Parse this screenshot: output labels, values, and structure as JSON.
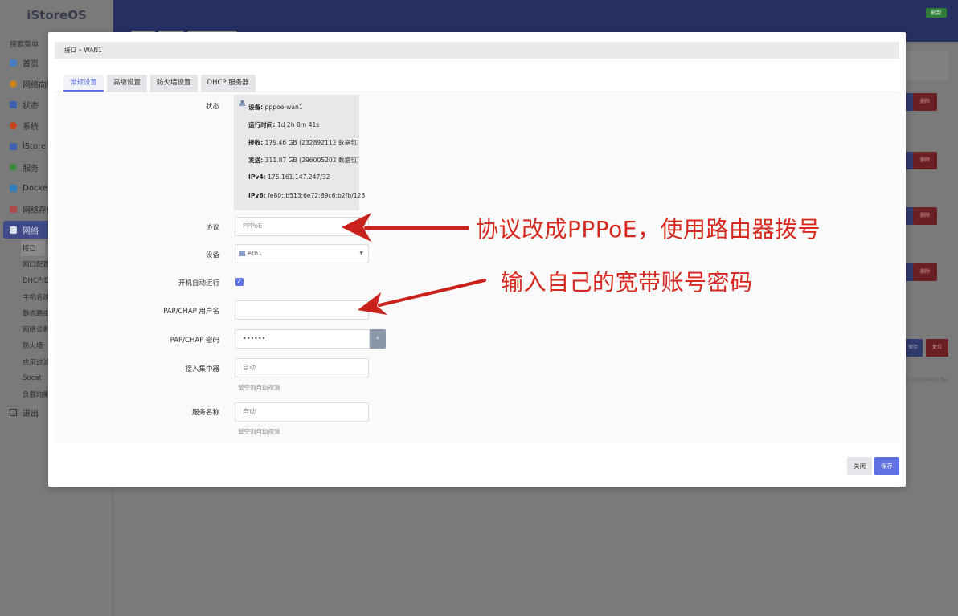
{
  "app": {
    "logo": "iStoreOS",
    "top_badge": "刷新"
  },
  "sidebar": {
    "search_label": "搜索菜单",
    "items": [
      {
        "label": "首页",
        "icon": "home-icon",
        "color": "#4a7bbf"
      },
      {
        "label": "网络向导",
        "icon": "wizard-icon",
        "color": "#c8871a"
      },
      {
        "label": "状态",
        "icon": "grid-icon",
        "color": "#3f5fb0"
      },
      {
        "label": "系统",
        "icon": "system-icon",
        "color": "#c2461e"
      },
      {
        "label": "iStore",
        "icon": "store-icon",
        "color": "#3f5fb0"
      },
      {
        "label": "服务",
        "icon": "service-icon",
        "color": "#3f8a3f"
      },
      {
        "label": "Docker",
        "icon": "docker-icon",
        "color": "#2f7fc0"
      },
      {
        "label": "网络存储",
        "icon": "storage-icon",
        "color": "#b04a4a"
      },
      {
        "label": "网络",
        "icon": "network-icon",
        "color": "#d8dbe9"
      }
    ],
    "sub_items": [
      "接口",
      "网口配置",
      "DHCP/DNS",
      "主机名映射",
      "静态路由",
      "网络诊断",
      "防火墙",
      "应用过滤",
      "Socat",
      "负载均衡"
    ],
    "logout_label": "退出"
  },
  "background": {
    "delete_label": "删除",
    "save_label": "保存",
    "reset_label": "复位",
    "footer": "v2.3-20230602.fnd"
  },
  "modal": {
    "breadcrumb": "接口 » WAN1",
    "tabs": [
      {
        "label": "常规设置",
        "active": true
      },
      {
        "label": "高级设置",
        "active": false
      },
      {
        "label": "防火墙设置",
        "active": false
      },
      {
        "label": "DHCP 服务器",
        "active": false
      }
    ],
    "status": {
      "label": "状态",
      "lines": [
        {
          "key": "设备:",
          "value": "pppoe-wan1"
        },
        {
          "key": "运行时间:",
          "value": "1d 2h 8m 41s"
        },
        {
          "key": "接收:",
          "value": "179.46 GB (232892112 数据包)"
        },
        {
          "key": "发送:",
          "value": "311.87 GB (296005202 数据包)"
        },
        {
          "key": "IPv4:",
          "value": "175.161.147.247/32"
        },
        {
          "key": "IPv6:",
          "value": "fe80::b513:6e72:69c6:b2fb/128"
        }
      ]
    },
    "protocol": {
      "label": "协议",
      "value": "PPPoE"
    },
    "device": {
      "label": "设备",
      "value": "eth1"
    },
    "autostart": {
      "label": "开机自动运行",
      "checked": true
    },
    "username": {
      "label": "PAP/CHAP 用户名",
      "value": ""
    },
    "password": {
      "label": "PAP/CHAP 密码",
      "value": "••••••",
      "reveal": "*"
    },
    "concentrator": {
      "label": "接入集中器",
      "placeholder": "自动",
      "help": "留空则自动探测"
    },
    "service_name": {
      "label": "服务名称",
      "placeholder": "自动",
      "help": "留空则自动探测"
    },
    "buttons": {
      "close": "关闭",
      "save": "保存"
    }
  },
  "annotations": {
    "color": "#d7281f",
    "protocol_note": "协议改成PPPoE，使用路由器拨号",
    "account_note": "输入自己的宽带账号密码"
  }
}
